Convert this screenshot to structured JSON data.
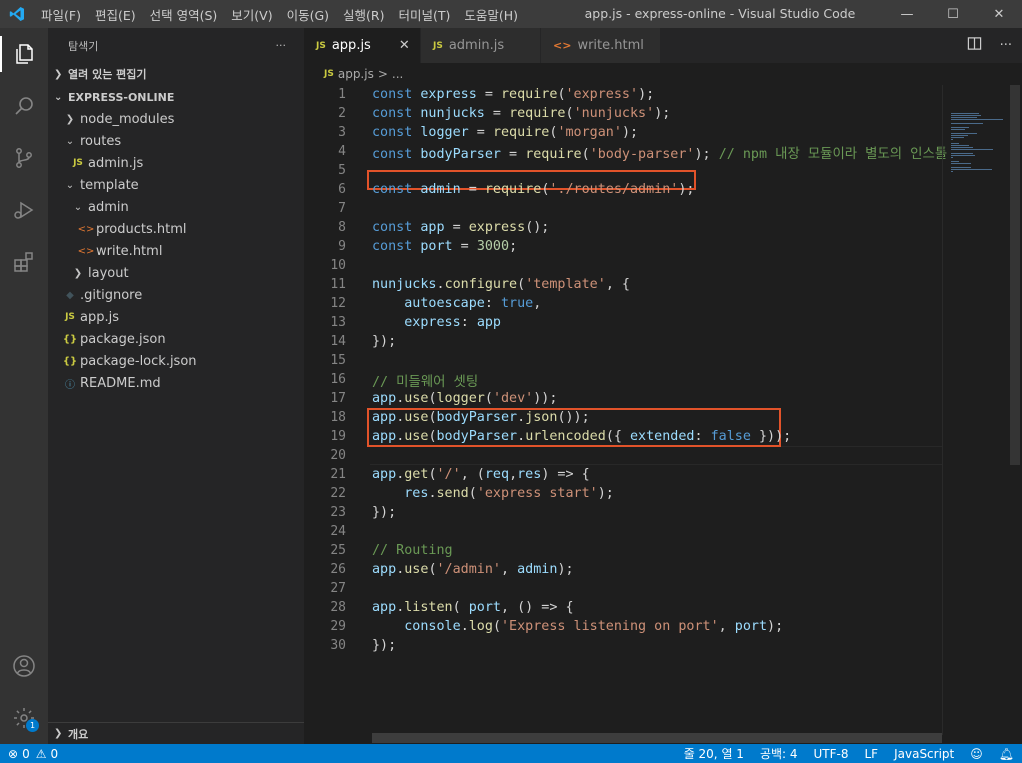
{
  "window": {
    "title": "app.js - express-online - Visual Studio Code",
    "menu": [
      "파일(F)",
      "편집(E)",
      "선택 영역(S)",
      "보기(V)",
      "이동(G)",
      "실행(R)",
      "터미널(T)",
      "도움말(H)"
    ],
    "controls": {
      "minimize": "—",
      "maximize": "☐",
      "close": "✕"
    }
  },
  "activity": {
    "items": [
      "files-icon",
      "search-icon",
      "source-control-icon",
      "run-debug-icon",
      "extensions-icon"
    ],
    "bottom": [
      "account-icon",
      "gear-icon"
    ],
    "badge": "1"
  },
  "sidebar": {
    "title": "탐색기",
    "more": "···",
    "open_editors": "열려 있는 편집기",
    "project": "EXPRESS-ONLINE",
    "tree": [
      {
        "label": "node_modules",
        "kind": "folder-closed",
        "depth": 1
      },
      {
        "label": "routes",
        "kind": "folder-open",
        "depth": 1
      },
      {
        "label": "admin.js",
        "kind": "js",
        "depth": 2
      },
      {
        "label": "template",
        "kind": "folder-open",
        "depth": 1
      },
      {
        "label": "admin",
        "kind": "folder-open",
        "depth": 2
      },
      {
        "label": "products.html",
        "kind": "html",
        "depth": 3
      },
      {
        "label": "write.html",
        "kind": "html",
        "depth": 3
      },
      {
        "label": "layout",
        "kind": "folder-closed",
        "depth": 2
      },
      {
        "label": ".gitignore",
        "kind": "git",
        "depth": 1
      },
      {
        "label": "app.js",
        "kind": "js",
        "depth": 1
      },
      {
        "label": "package.json",
        "kind": "json",
        "depth": 1
      },
      {
        "label": "package-lock.json",
        "kind": "json",
        "depth": 1
      },
      {
        "label": "README.md",
        "kind": "info",
        "depth": 1
      }
    ],
    "outline": "개요"
  },
  "tabs": [
    {
      "label": "app.js",
      "icon": "JS",
      "active": true,
      "close": "✕"
    },
    {
      "label": "admin.js",
      "icon": "JS",
      "active": false
    },
    {
      "label": "write.html",
      "icon": "<>",
      "active": false
    }
  ],
  "breadcrumb": {
    "file": "app.js",
    "sep": ">",
    "rest": "..."
  },
  "code_lines": [
    "const express = require('express');",
    "const nunjucks = require('nunjucks');",
    "const logger = require('morgan');",
    "const bodyParser = require('body-parser'); // npm 내장 모듈이라 별도의 인스톨",
    "",
    "const admin = require('./routes/admin');",
    "",
    "const app = express();",
    "const port = 3000;",
    "",
    "nunjucks.configure('template', {",
    "    autoescape: true,",
    "    express: app",
    "});",
    "",
    "// 미들웨어 셋팅",
    "app.use(logger('dev'));",
    "app.use(bodyParser.json());",
    "app.use(bodyParser.urlencoded({ extended: false }));",
    "",
    "app.get('/', (req,res) => {",
    "    res.send('express start');",
    "});",
    "",
    "// Routing",
    "app.use('/admin', admin);",
    "",
    "app.listen( port, () => {",
    "    console.log('Express listening on port', port);",
    "});"
  ],
  "status": {
    "errors": "0",
    "warnings": "0",
    "position": "줄 20, 열 1",
    "spaces": "공백: 4",
    "encoding": "UTF-8",
    "eol": "LF",
    "language": "JavaScript"
  },
  "colors": {
    "accent": "#007acc",
    "highlight_box": "#e2532a"
  }
}
